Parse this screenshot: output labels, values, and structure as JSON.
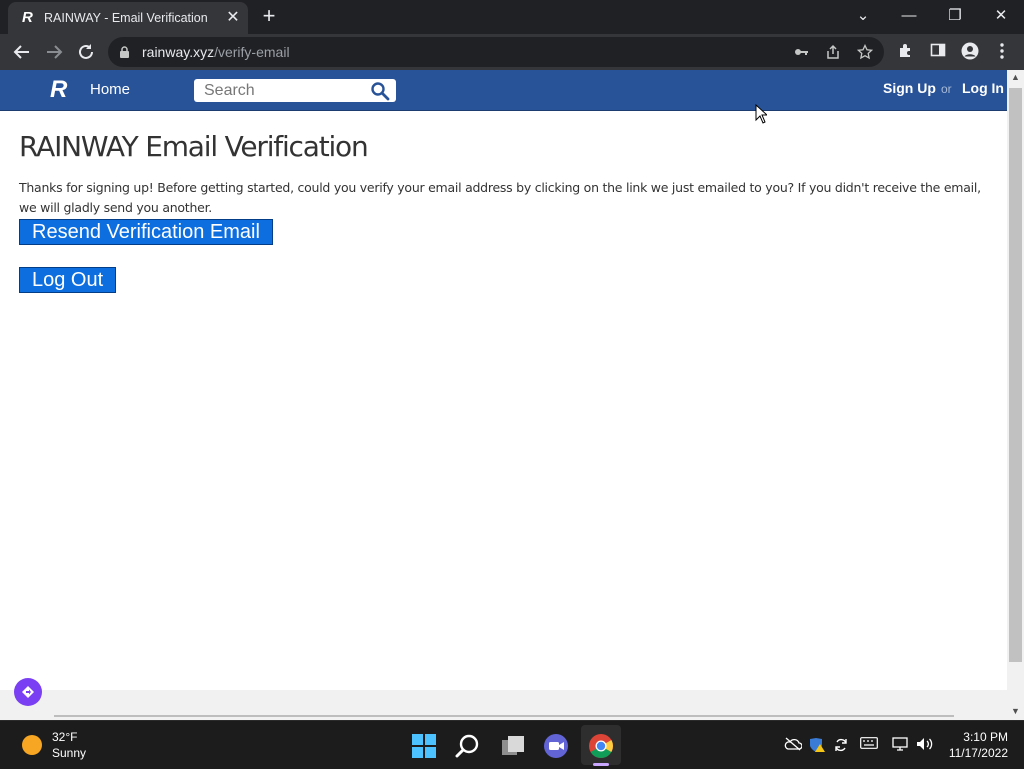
{
  "browser": {
    "tab_title": "RAINWAY - Email Verification",
    "tab_favicon": "R",
    "tab_close": "✕",
    "new_tab": "+",
    "url_host": "rainway.xyz",
    "url_path": "/verify-email",
    "controls": {
      "list": "⌄",
      "minimize": "—",
      "restore": "❐",
      "close": "✕"
    }
  },
  "site": {
    "logo_letter": "R",
    "nav": {
      "home": "Home"
    },
    "search": {
      "placeholder": "Search"
    },
    "auth": {
      "signup": "Sign Up",
      "or": "or",
      "login": "Log In"
    }
  },
  "page": {
    "title": "RAINWAY Email Verification",
    "message": "Thanks for signing up! Before getting started, could you verify your email address by clicking on the link we just emailed to you? If you didn't receive the email, we will gladly send you another.",
    "resend_button": "Resend Verification Email",
    "logout_button": "Log Out"
  },
  "taskbar": {
    "weather": {
      "temp": "32°F",
      "condition": "Sunny"
    },
    "clock": {
      "time": "3:10 PM",
      "date": "11/17/2022"
    }
  },
  "colors": {
    "site_header": "#285398",
    "primary_button": "#0d6ee0",
    "browser_dark": "#202124",
    "taskbar": "#1c1c1c"
  }
}
